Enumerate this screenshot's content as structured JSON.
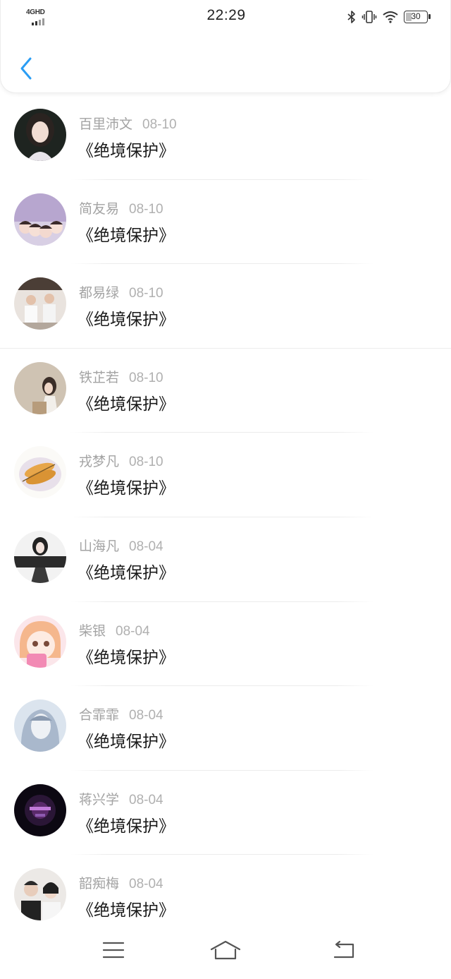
{
  "status_bar": {
    "network": "4GHD",
    "time": "22:29",
    "battery": "30",
    "battery_level": 0.3,
    "icons": [
      "bluetooth-icon",
      "vibrate-icon",
      "wifi-icon",
      "battery-icon"
    ]
  },
  "header": {
    "back_icon": "chevron-left-icon",
    "accent_color": "#2a9df4"
  },
  "list": {
    "items": [
      {
        "name": "百里沛文",
        "date": "08-10",
        "title": "《绝境保护》"
      },
      {
        "name": "简友易",
        "date": "08-10",
        "title": "《绝境保护》"
      },
      {
        "name": "都易绿",
        "date": "08-10",
        "title": "《绝境保护》"
      },
      {
        "name": "铁芷若",
        "date": "08-10",
        "title": "《绝境保护》"
      },
      {
        "name": "戎梦凡",
        "date": "08-10",
        "title": "《绝境保护》"
      },
      {
        "name": "山海凡",
        "date": "08-04",
        "title": "《绝境保护》"
      },
      {
        "name": "柴银",
        "date": "08-04",
        "title": "《绝境保护》"
      },
      {
        "name": "合霏霏",
        "date": "08-04",
        "title": "《绝境保护》"
      },
      {
        "name": "蒋兴学",
        "date": "08-04",
        "title": "《绝境保护》"
      },
      {
        "name": "韶痴梅",
        "date": "08-04",
        "title": "《绝境保护》"
      }
    ]
  },
  "nav": {
    "icons": [
      "menu-icon",
      "home-icon",
      "back-icon"
    ]
  }
}
